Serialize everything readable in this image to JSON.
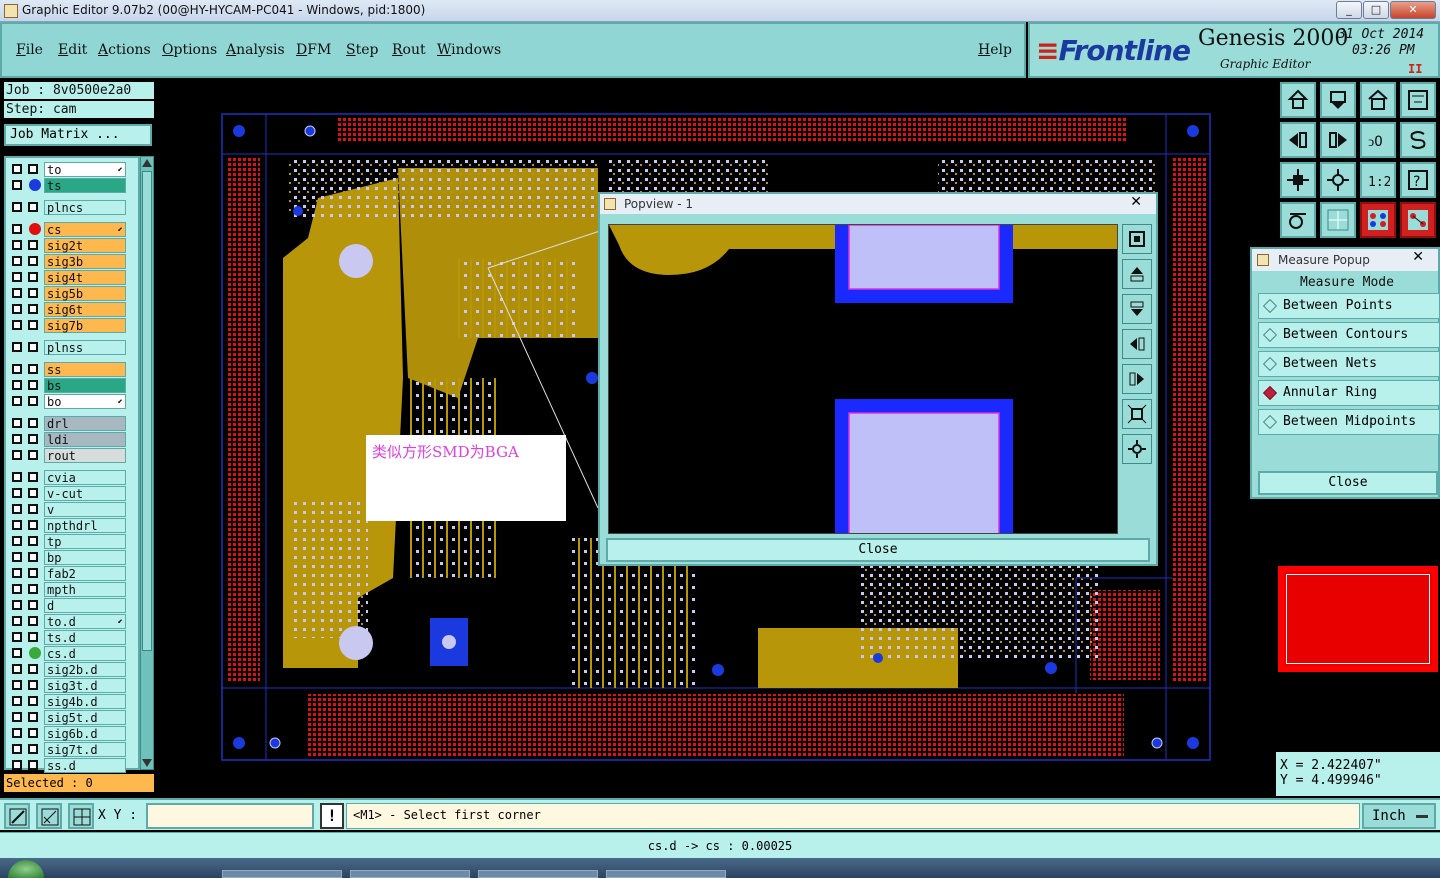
{
  "window": {
    "title": "Graphic Editor 9.07b2 (00@HY-HYCAM-PC041 - Windows, pid:1800)",
    "minimize": "_",
    "maximize": "□",
    "close": "✕"
  },
  "menu": {
    "items": [
      "File",
      "Edit",
      "Actions",
      "Options",
      "Analysis",
      "DFM",
      "Step",
      "Rout",
      "Windows"
    ],
    "help": "Help"
  },
  "brand": {
    "logo": "Frontline",
    "product": "Genesis 2000",
    "subtitle": "Graphic Editor",
    "date": "31 Oct 2014",
    "time": "03:26 PM",
    "pause": "II"
  },
  "job": {
    "job_line": "Job : 8v0500e2a0",
    "step_line": "Step: cam",
    "matrix_button": "Job Matrix ..."
  },
  "layers": [
    {
      "name": "to",
      "color": "#ffffff",
      "dot": "",
      "arrow": true
    },
    {
      "name": "ts",
      "color": "#2aa886",
      "dot": "#1a3adf",
      "arrow": false
    },
    {
      "name": "plncs",
      "color": "#b8f0ec",
      "dot": "",
      "arrow": false
    },
    {
      "name": "cs",
      "color": "#ffb84d",
      "dot": "#e01010",
      "arrow": true
    },
    {
      "name": "sig2t",
      "color": "#ffb84d",
      "dot": "",
      "arrow": false
    },
    {
      "name": "sig3b",
      "color": "#ffb84d",
      "dot": "",
      "arrow": false
    },
    {
      "name": "sig4t",
      "color": "#ffb84d",
      "dot": "",
      "arrow": false
    },
    {
      "name": "sig5b",
      "color": "#ffb84d",
      "dot": "",
      "arrow": false
    },
    {
      "name": "sig6t",
      "color": "#ffb84d",
      "dot": "",
      "arrow": false
    },
    {
      "name": "sig7b",
      "color": "#ffb84d",
      "dot": "",
      "arrow": false
    },
    {
      "name": "plnss",
      "color": "#b8f0ec",
      "dot": "",
      "arrow": false
    },
    {
      "name": "ss",
      "color": "#ffb84d",
      "dot": "",
      "arrow": false
    },
    {
      "name": "bs",
      "color": "#2aa886",
      "dot": "",
      "arrow": false
    },
    {
      "name": "bo",
      "color": "#ffffff",
      "dot": "",
      "arrow": true
    },
    {
      "name": "drl",
      "color": "#a8b8c0",
      "dot": "",
      "arrow": false
    },
    {
      "name": "ldi",
      "color": "#a8b8c0",
      "dot": "",
      "arrow": false
    },
    {
      "name": "rout",
      "color": "#d8dcdc",
      "dot": "",
      "arrow": false
    },
    {
      "name": "cvia",
      "color": "#b8f0ec",
      "dot": "",
      "arrow": false
    },
    {
      "name": "v-cut",
      "color": "#b8f0ec",
      "dot": "",
      "arrow": false
    },
    {
      "name": "v",
      "color": "#b8f0ec",
      "dot": "",
      "arrow": false
    },
    {
      "name": "npthdrl",
      "color": "#b8f0ec",
      "dot": "",
      "arrow": false
    },
    {
      "name": "tp",
      "color": "#b8f0ec",
      "dot": "",
      "arrow": false
    },
    {
      "name": "bp",
      "color": "#b8f0ec",
      "dot": "",
      "arrow": false
    },
    {
      "name": "fab2",
      "color": "#b8f0ec",
      "dot": "",
      "arrow": false
    },
    {
      "name": "mpth",
      "color": "#b8f0ec",
      "dot": "",
      "arrow": false
    },
    {
      "name": "d",
      "color": "#b8f0ec",
      "dot": "",
      "arrow": false
    },
    {
      "name": "to.d",
      "color": "#b8f0ec",
      "dot": "",
      "arrow": true
    },
    {
      "name": "ts.d",
      "color": "#b8f0ec",
      "dot": "",
      "arrow": false
    },
    {
      "name": "cs.d",
      "color": "#b8f0ec",
      "dot": "#3aa83a",
      "arrow": false
    },
    {
      "name": "sig2b.d",
      "color": "#b8f0ec",
      "dot": "",
      "arrow": false
    },
    {
      "name": "sig3t.d",
      "color": "#b8f0ec",
      "dot": "",
      "arrow": false
    },
    {
      "name": "sig4b.d",
      "color": "#b8f0ec",
      "dot": "",
      "arrow": false
    },
    {
      "name": "sig5t.d",
      "color": "#b8f0ec",
      "dot": "",
      "arrow": false
    },
    {
      "name": "sig6b.d",
      "color": "#b8f0ec",
      "dot": "",
      "arrow": false
    },
    {
      "name": "sig7t.d",
      "color": "#b8f0ec",
      "dot": "",
      "arrow": false
    },
    {
      "name": "ss.d",
      "color": "#b8f0ec",
      "dot": "",
      "arrow": false
    }
  ],
  "selected": "Selected : 0",
  "annotation": "类似方形SMD为BGA",
  "popview": {
    "title": "Popview - 1",
    "close_x": "✕",
    "close": "Close"
  },
  "measure": {
    "title": "Measure Popup",
    "close_x": "✕",
    "header": "Measure Mode",
    "options": [
      {
        "label": "Between Points",
        "active": false
      },
      {
        "label": "Between Contours",
        "active": false
      },
      {
        "label": "Between Nets",
        "active": false
      },
      {
        "label": "Annular Ring",
        "active": true
      },
      {
        "label": "Between Midpoints",
        "active": false
      }
    ],
    "close": "Close"
  },
  "coords": {
    "x": "X = 2.422407\"",
    "y": "Y = 4.499946\""
  },
  "bottom": {
    "xy_label": "X Y :",
    "xy_value": "",
    "warn": "!",
    "prompt": "<M1> - Select first corner",
    "units": "Inch"
  },
  "status": "cs.d -> cs : 0.00025",
  "colors": {
    "panel": "#b8f0ec",
    "board_copper": "#b8960a",
    "pad_red": "#e01010",
    "via_blue": "#1a3adf",
    "pad_lavender": "#c0c0f8"
  }
}
